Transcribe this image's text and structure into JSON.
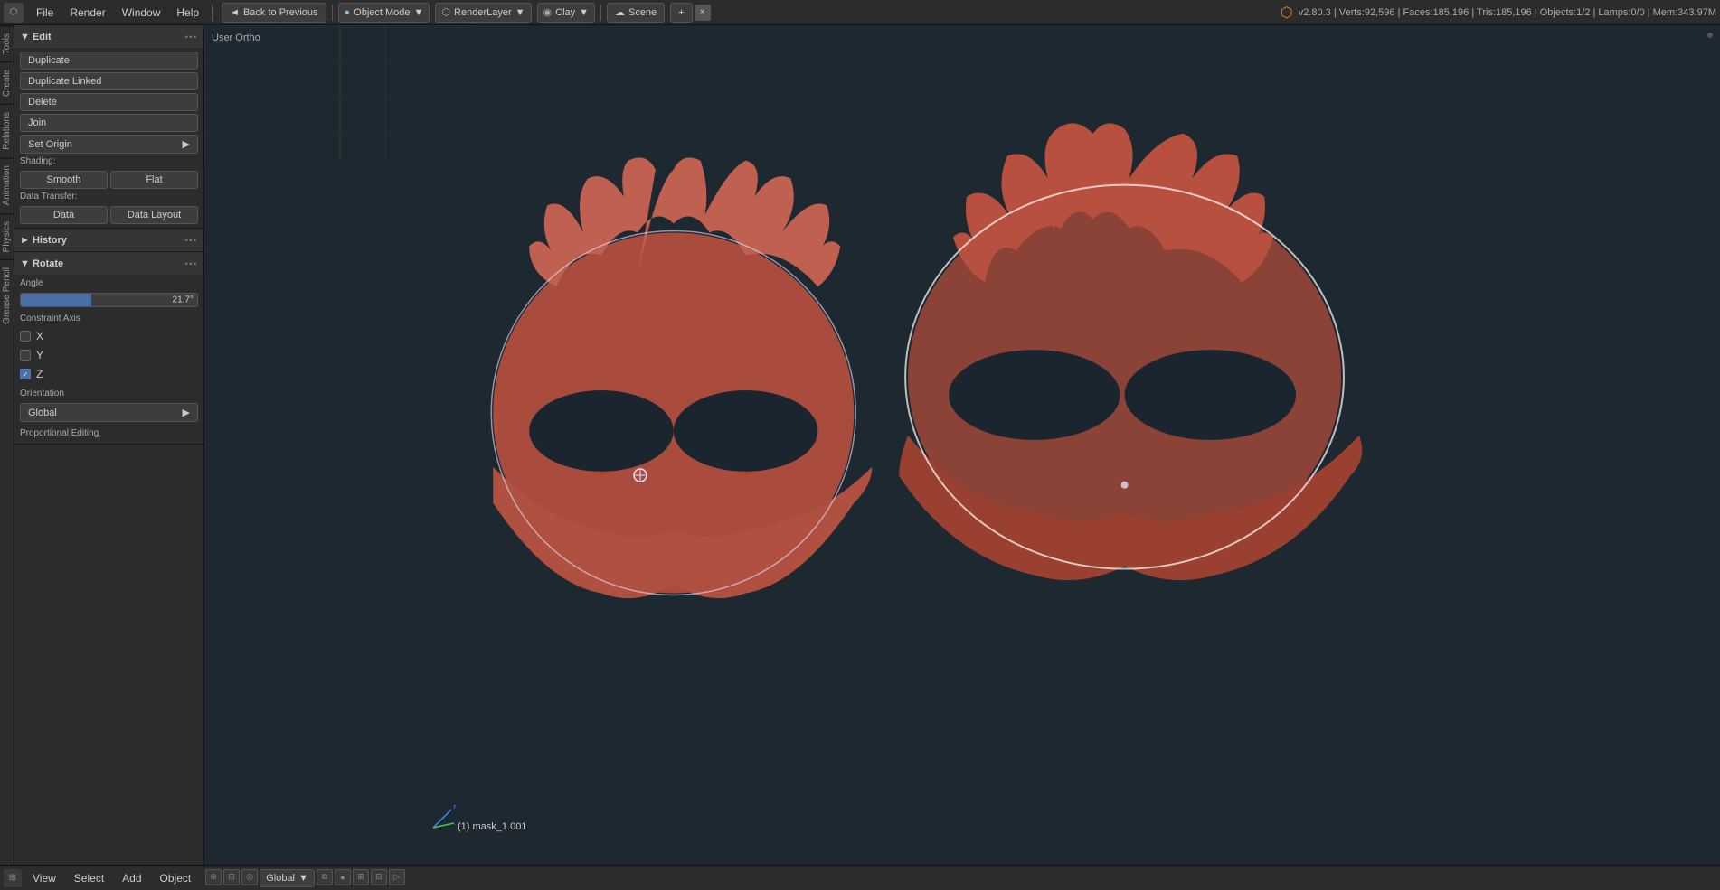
{
  "topbar": {
    "blender_icon": "⬡",
    "menus": [
      "File",
      "Render",
      "Window",
      "Help"
    ],
    "back_button": "Back to Previous",
    "back_icon": "◄",
    "object_mode": "Object Mode",
    "render_layer": "RenderLayer",
    "clay": "Clay",
    "clay_icon": "▼",
    "scene_icon": "☁",
    "scene": "Scene",
    "add_btn": "+",
    "close_btn": "×",
    "version_info": "v2.80.3 | Verts:92,596 | Faces:185,196 | Tris:185,196 | Objects:1/2 | Lamps:0/0 | Mem:343.97M"
  },
  "sidebar": {
    "tabs": [
      "Tools",
      "Create",
      "Relations",
      "Animation",
      "Physics",
      "Grease Pencil"
    ]
  },
  "left_panel": {
    "edit_section": {
      "title": "▼ Edit",
      "buttons": [
        "Duplicate",
        "Duplicate Linked",
        "Delete",
        "Join"
      ],
      "set_origin": "Set Origin",
      "shading_label": "Shading:",
      "smooth_btn": "Smooth",
      "flat_btn": "Flat",
      "data_transfer_label": "Data Transfer:",
      "data_btn": "Data",
      "data_layout_btn": "Data Layout"
    },
    "history_section": {
      "title": "► History"
    },
    "rotate_section": {
      "title": "▼ Rotate",
      "angle_label": "Angle",
      "angle_value": "21.7°",
      "constraint_label": "Constraint Axis",
      "x_label": "X",
      "y_label": "Y",
      "z_label": "Z",
      "x_checked": false,
      "y_checked": false,
      "z_checked": true,
      "orientation_label": "Orientation",
      "global_option": "Global",
      "proportional_label": "Proportional Editing"
    }
  },
  "viewport": {
    "label": "User Ortho",
    "mesh_label": "(1) mask_1.001"
  },
  "bottombar": {
    "view_label": "View",
    "select_label": "Select",
    "add_label": "Add",
    "object_label": "Object",
    "global_dropdown": "Global"
  }
}
